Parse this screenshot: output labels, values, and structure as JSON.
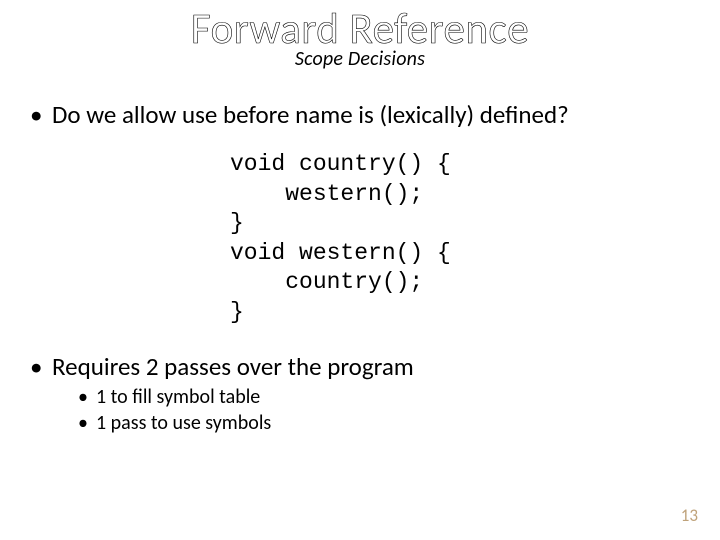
{
  "title": "Forward Reference",
  "subtitle": "Scope Decisions",
  "bullets": {
    "b1": "Do we allow use before name is (lexically) defined?",
    "b2": "Requires 2 passes over the program",
    "sub1": "1 to fill symbol table",
    "sub2": "1 pass to use symbols"
  },
  "code": "void country() {\n    western();\n}\nvoid western() {\n    country();\n}",
  "page_number": "13"
}
